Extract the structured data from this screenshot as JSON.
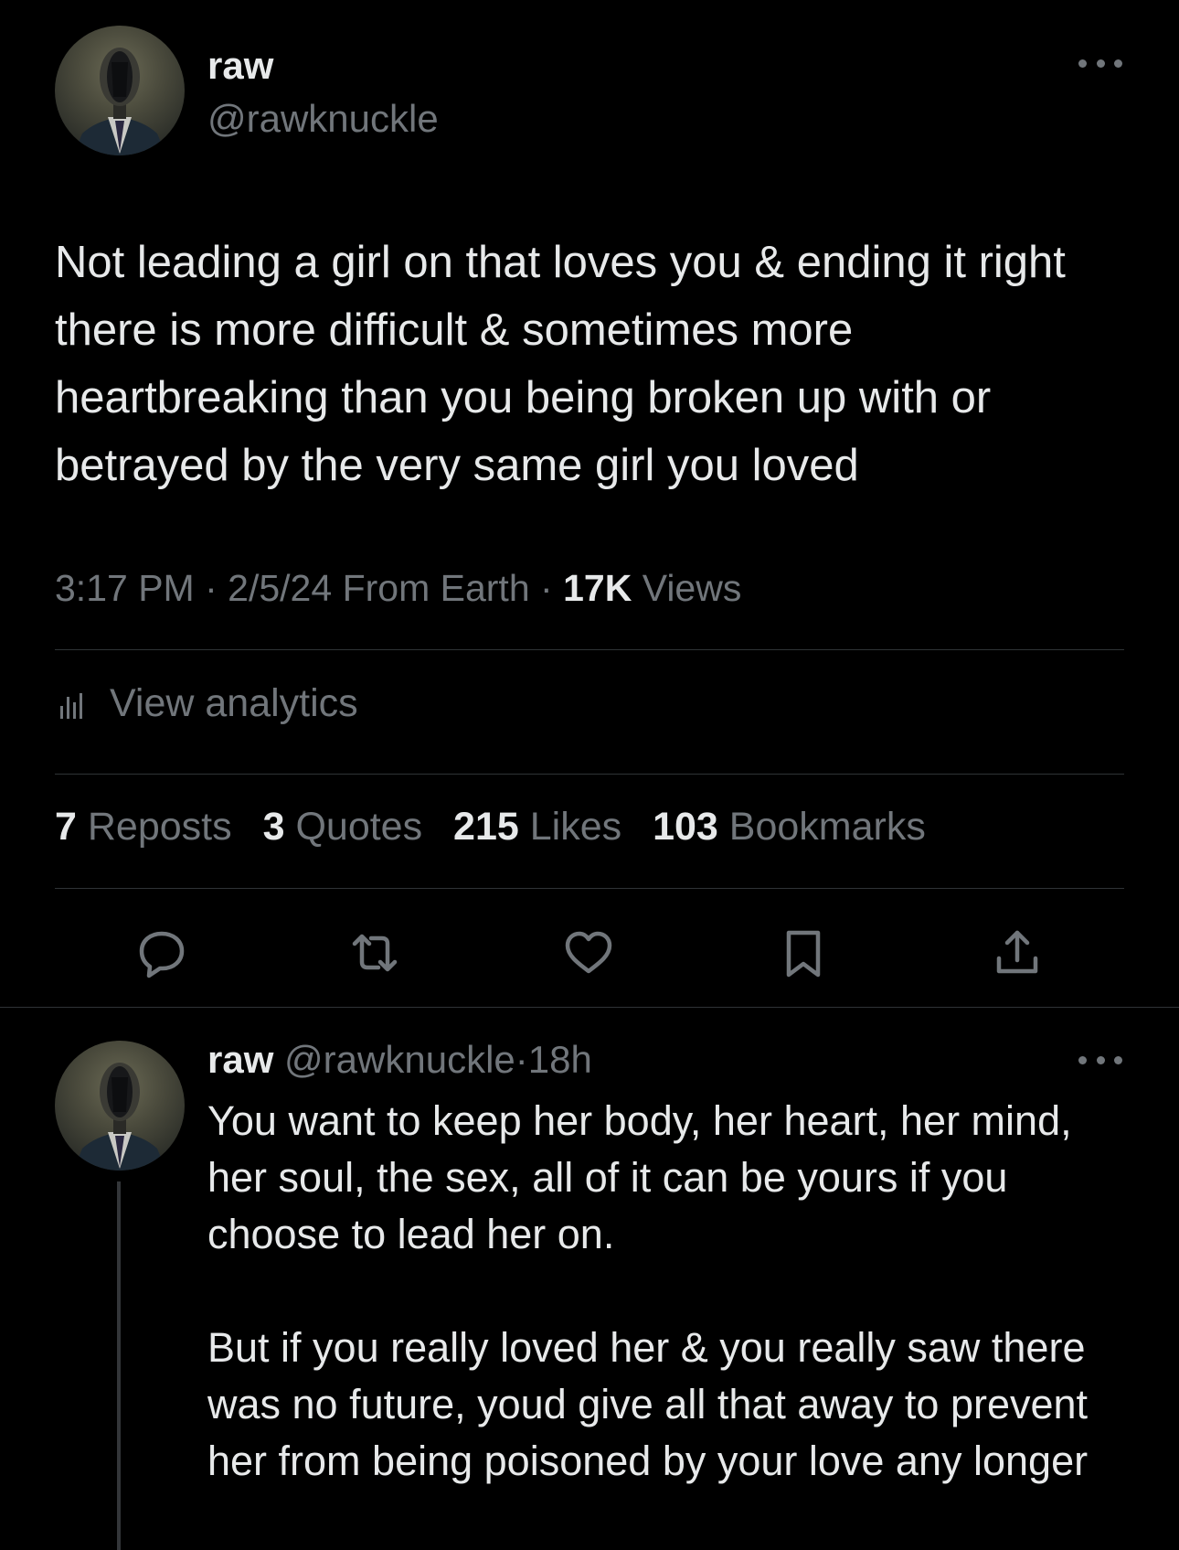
{
  "tweet": {
    "author_name": "raw",
    "author_handle": "@rawknuckle",
    "text": "Not leading a girl on that loves you & ending it right there is more difficult & sometimes more heartbreaking than you being broken up with or betrayed by the very same girl you loved",
    "time": "3:17 PM",
    "date": "2/5/24",
    "location": "From Earth",
    "views_count": "17K",
    "views_label": "Views",
    "separator": "·"
  },
  "analytics": {
    "label": "View analytics",
    "icon": "bar-chart-icon"
  },
  "stats": [
    {
      "count": "7",
      "label": "Reposts"
    },
    {
      "count": "3",
      "label": "Quotes"
    },
    {
      "count": "215",
      "label": "Likes"
    },
    {
      "count": "103",
      "label": "Bookmarks"
    }
  ],
  "actions": [
    {
      "name": "reply",
      "icon": "reply-icon"
    },
    {
      "name": "repost",
      "icon": "repost-icon"
    },
    {
      "name": "like",
      "icon": "heart-icon"
    },
    {
      "name": "bookmark",
      "icon": "bookmark-icon"
    },
    {
      "name": "share",
      "icon": "share-icon"
    }
  ],
  "reply": {
    "author_name": "raw",
    "author_handle": "@rawknuckle",
    "separator": "·",
    "time": "18h",
    "paragraph_1": "You want to keep her body, her heart, her mind, her soul, the sex, all of it can be yours if you choose to lead her on.",
    "paragraph_2": "But if you really loved her & you really saw there was no future, youd give all that away to prevent her from being poisoned by your love any longer"
  },
  "colors": {
    "background": "#000000",
    "text_primary": "#e7e9ea",
    "text_secondary": "#71767b",
    "divider": "#2f3336"
  }
}
